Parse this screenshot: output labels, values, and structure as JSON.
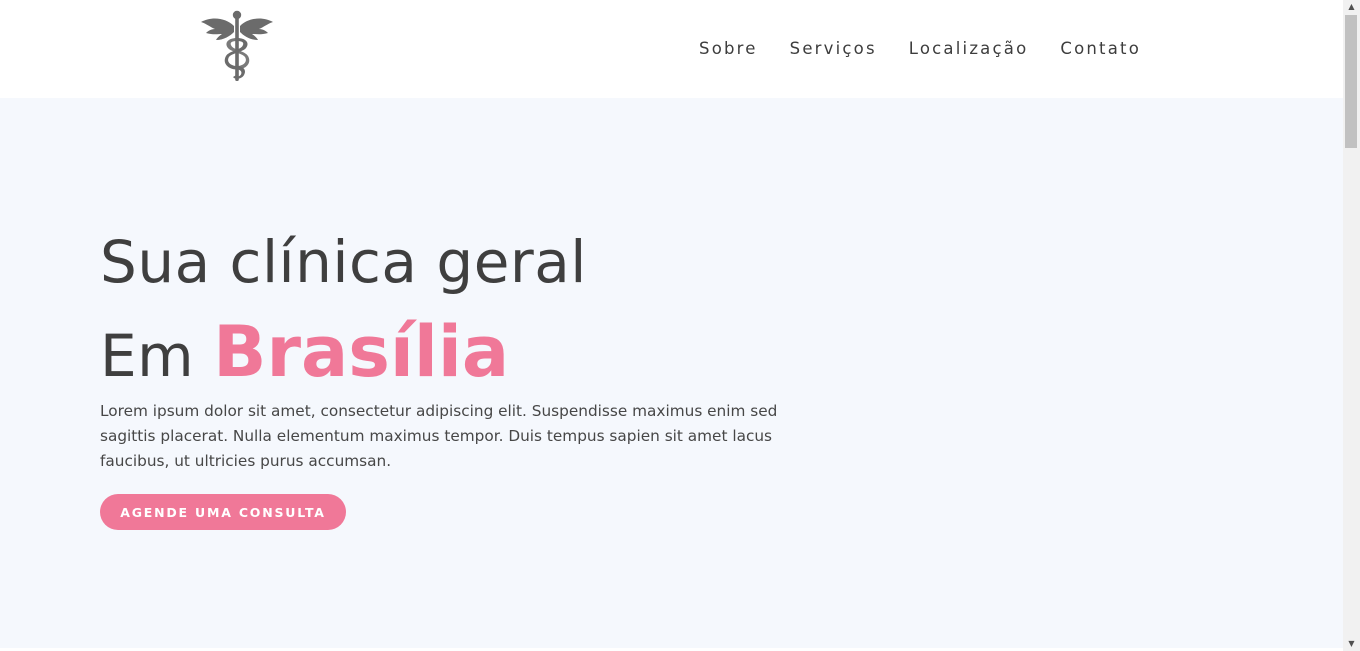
{
  "brand": {
    "logo_icon": "caduceus-icon",
    "logo_color": "#6b6b6b"
  },
  "nav": {
    "items": [
      {
        "label": "Sobre"
      },
      {
        "label": "Serviços"
      },
      {
        "label": "Localização"
      },
      {
        "label": "Contato"
      }
    ]
  },
  "hero": {
    "title_line1": "Sua clínica geral",
    "title_line2_prefix": "Em",
    "title_line2_accent": "Brasília",
    "description": "Lorem ipsum dolor sit amet, consectetur adipiscing elit. Suspendisse maximus enim sed sagittis placerat. Nulla elementum maximus tempor. Duis tempus sapien sit amet lacus faucibus, ut ultricies purus accumsan.",
    "cta_label": "AGENDE UMA CONSULTA"
  },
  "colors": {
    "accent": "#f07898",
    "text": "#3f3f3f",
    "hero_background": "#f5f8fd"
  }
}
